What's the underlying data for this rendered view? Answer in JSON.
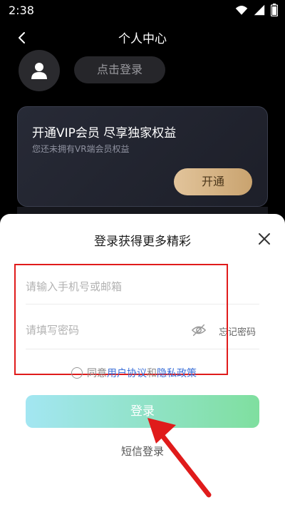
{
  "status_bar": {
    "time": "2:38",
    "icons": [
      "wifi-icon",
      "signal-icon",
      "battery-icon"
    ]
  },
  "header": {
    "title": "个人中心",
    "back_icon": "chevron-left-icon"
  },
  "profile": {
    "avatar_icon": "user-icon",
    "login_label": "点击登录"
  },
  "vip_card": {
    "title": "开通VIP会员 尽享独家权益",
    "subtitle": "您还未拥有VR端会员权益",
    "button_label": "开通"
  },
  "login_sheet": {
    "title": "登录获得更多精彩",
    "close_icon": "close-icon",
    "phone_placeholder": "请输入手机号或邮箱",
    "password_placeholder": "请填写密码",
    "eye_icon": "eye-off-icon",
    "forgot_label": "忘记密码",
    "agree_prefix": "同意",
    "user_agreement": "用户协议",
    "agree_and": "和",
    "privacy_policy": "隐私政策",
    "login_button": "登录",
    "sms_login": "短信登录"
  },
  "colors": {
    "accent_red": "#e01b1b",
    "link_blue": "#3a6fd8",
    "vip_gold": "#d8b585",
    "login_gradient_start": "#a3e6f2",
    "login_gradient_end": "#7fdf9f"
  }
}
